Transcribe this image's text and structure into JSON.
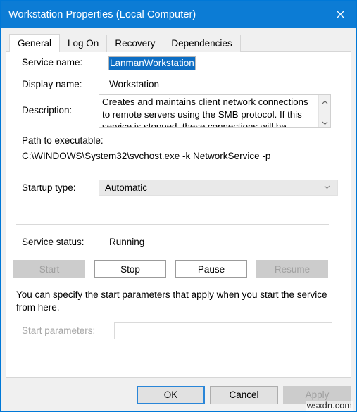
{
  "window": {
    "title": "Workstation Properties (Local Computer)",
    "close_icon": "close-icon",
    "titlebar_color": "#0c7cd5"
  },
  "tabs": [
    {
      "label": "General",
      "active": true
    },
    {
      "label": "Log On",
      "active": false
    },
    {
      "label": "Recovery",
      "active": false
    },
    {
      "label": "Dependencies",
      "active": false
    }
  ],
  "general": {
    "service_name_label": "Service name:",
    "service_name_value": "LanmanWorkstation",
    "display_name_label": "Display name:",
    "display_name_value": "Workstation",
    "description_label": "Description:",
    "description_value": "Creates and maintains client network connections to remote servers using the SMB protocol. If this service is stopped, these connections will be unavailable. If",
    "scroll_up_icon": "chevron-up-icon",
    "scroll_down_icon": "chevron-down-icon",
    "path_label": "Path to executable:",
    "path_value": "C:\\WINDOWS\\System32\\svchost.exe -k NetworkService -p",
    "startup_type_label": "Startup type:",
    "startup_type_value": "Automatic",
    "startup_type_arrow_icon": "chevron-down-icon",
    "service_status_label": "Service status:",
    "service_status_value": "Running",
    "controls": [
      {
        "label": "Start",
        "enabled": false
      },
      {
        "label": "Stop",
        "enabled": true
      },
      {
        "label": "Pause",
        "enabled": true
      },
      {
        "label": "Resume",
        "enabled": false
      }
    ],
    "hint_text": "You can specify the start parameters that apply when you start the service from here.",
    "start_parameters_label": "Start parameters:",
    "start_parameters_value": "",
    "start_parameters_placeholder": ""
  },
  "footer": {
    "ok_label": "OK",
    "cancel_label": "Cancel",
    "apply_label": "Apply",
    "apply_enabled": false
  },
  "watermark": "wsxdn.com"
}
